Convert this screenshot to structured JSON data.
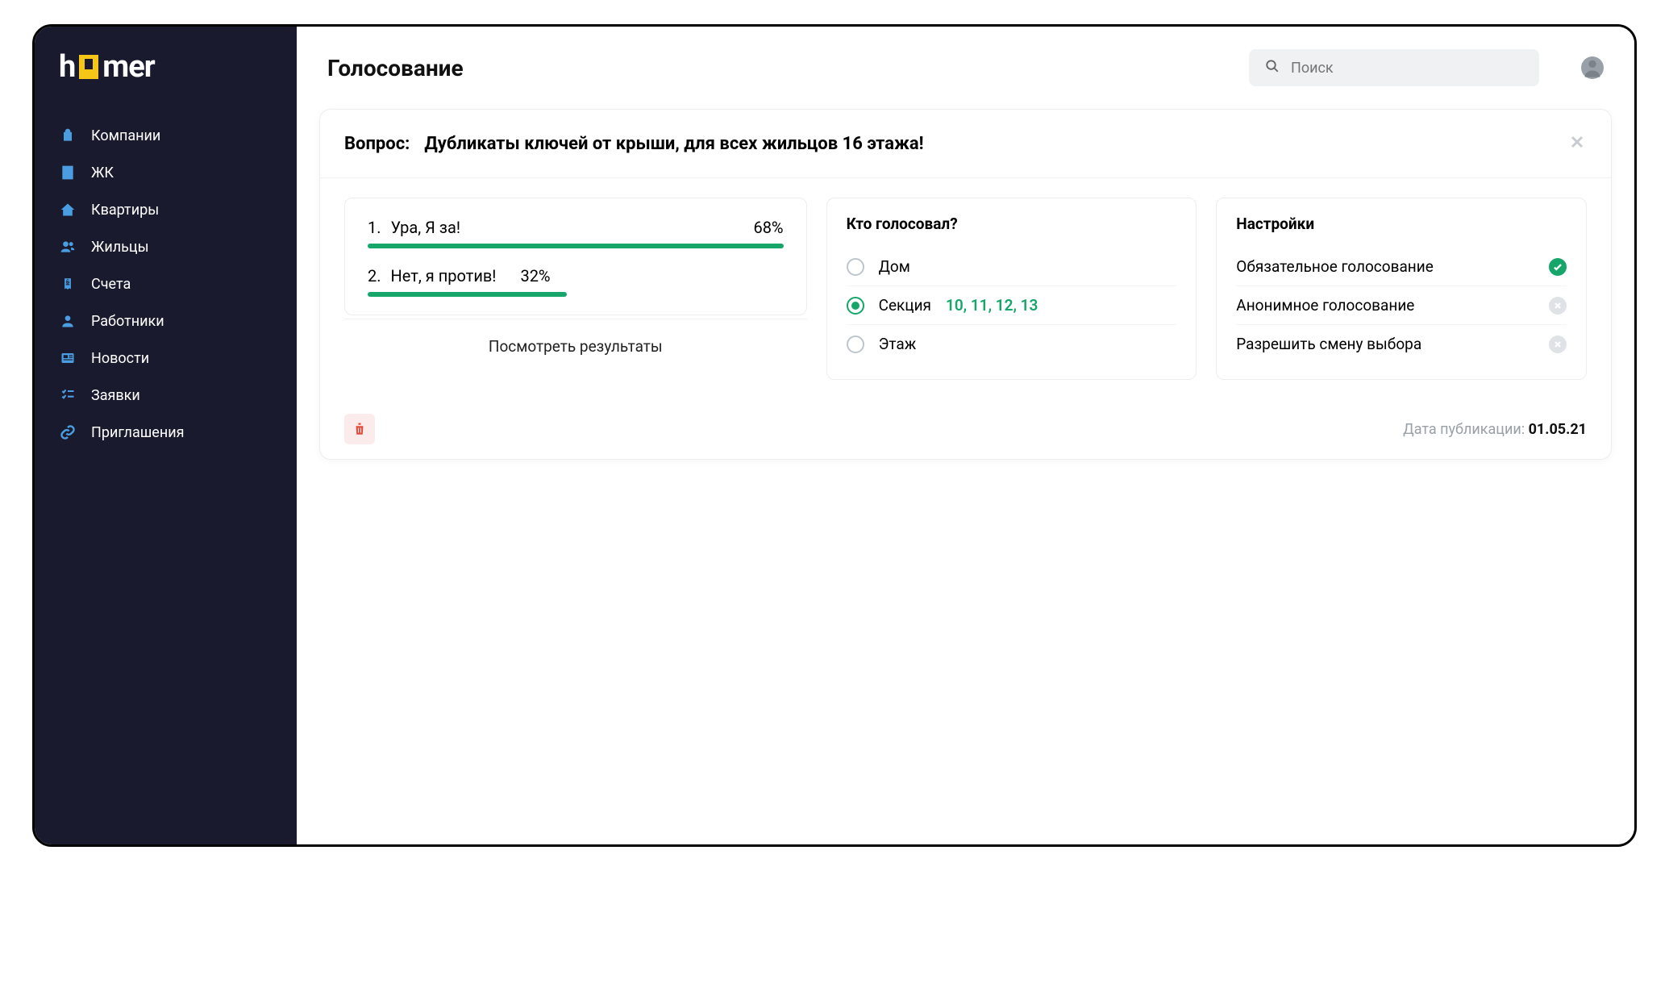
{
  "logo": {
    "part1": "h",
    "part3": "mer"
  },
  "sidebar": {
    "items": [
      {
        "label": "Компании"
      },
      {
        "label": "ЖК"
      },
      {
        "label": "Квартиры"
      },
      {
        "label": "Жильцы"
      },
      {
        "label": "Счета"
      },
      {
        "label": "Работники"
      },
      {
        "label": "Новости"
      },
      {
        "label": "Заявки"
      },
      {
        "label": "Приглашения"
      }
    ]
  },
  "header": {
    "title": "Голосование",
    "search_placeholder": "Поиск"
  },
  "question": {
    "label": "Вопрос:",
    "text": "Дубликаты ключей от крыши, для всех жильцов 16 этажа!"
  },
  "poll": {
    "options": [
      {
        "num": "1.",
        "text": "Ура, Я за!",
        "pct": "68%",
        "width": "100%"
      },
      {
        "num": "2.",
        "text": "Нет, я против!",
        "pct": "32%",
        "width": "48%"
      }
    ],
    "results_label": "Посмотреть результаты"
  },
  "voters": {
    "title": "Кто голосовал?",
    "rows": [
      {
        "label": "Дом",
        "selected": false,
        "values": ""
      },
      {
        "label": "Секция",
        "selected": true,
        "values": "10, 11, 12, 13"
      },
      {
        "label": "Этаж",
        "selected": false,
        "values": ""
      }
    ]
  },
  "settings": {
    "title": "Настройки",
    "rows": [
      {
        "label": "Обязательное голосование",
        "on": true
      },
      {
        "label": "Анонимное голосование",
        "on": false
      },
      {
        "label": "Разрешить смену выбора",
        "on": false
      }
    ]
  },
  "footer": {
    "pub_label": "Дата публикации: ",
    "pub_date": "01.05.21"
  }
}
